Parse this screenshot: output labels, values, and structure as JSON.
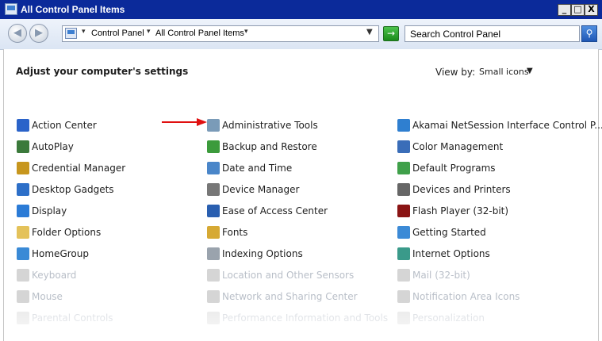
{
  "window": {
    "title": "All Control Panel Items"
  },
  "titlebar_buttons": {
    "minimize": "_",
    "maximize": "□",
    "close": "X"
  },
  "nav": {
    "back": "◀",
    "forward": "▶",
    "breadcrumbs": [
      "Control Panel",
      "All Control Panel Items"
    ],
    "refresh": "→",
    "search_placeholder": "Search Control Panel",
    "search_btn": "⚲"
  },
  "header": {
    "title": "Adjust your computer's settings",
    "view_by_label": "View by:",
    "view_by_value": "Small icons"
  },
  "items": {
    "col1": [
      {
        "label": "Action Center",
        "icon": "flag-icon",
        "color": "#2a63c9"
      },
      {
        "label": "AutoPlay",
        "icon": "autoplay-icon",
        "color": "#3b7a3b"
      },
      {
        "label": "Credential Manager",
        "icon": "vault-icon",
        "color": "#c7961e"
      },
      {
        "label": "Desktop Gadgets",
        "icon": "gadgets-icon",
        "color": "#2d6fc8"
      },
      {
        "label": "Display",
        "icon": "monitor-icon",
        "color": "#2b7bd6"
      },
      {
        "label": "Folder Options",
        "icon": "folder-icon",
        "color": "#e4c25a"
      },
      {
        "label": "HomeGroup",
        "icon": "homegroup-icon",
        "color": "#3a8ad6"
      },
      {
        "label": "Keyboard",
        "icon": "keyboard-icon",
        "color": "#888"
      },
      {
        "label": "Mouse",
        "icon": "mouse-icon",
        "color": "#888"
      },
      {
        "label": "Parental Controls",
        "icon": "parental-icon",
        "color": "#888"
      }
    ],
    "col2": [
      {
        "label": "Administrative Tools",
        "icon": "admin-tools-icon",
        "color": "#7a9bb8"
      },
      {
        "label": "Backup and Restore",
        "icon": "backup-icon",
        "color": "#3c9b3c"
      },
      {
        "label": "Date and Time",
        "icon": "clock-icon",
        "color": "#4a86c9"
      },
      {
        "label": "Device Manager",
        "icon": "device-manager-icon",
        "color": "#777"
      },
      {
        "label": "Ease of Access Center",
        "icon": "ease-access-icon",
        "color": "#2a5fb0"
      },
      {
        "label": "Fonts",
        "icon": "fonts-icon",
        "color": "#d6a934"
      },
      {
        "label": "Indexing Options",
        "icon": "indexing-icon",
        "color": "#9aa3ad"
      },
      {
        "label": "Location and Other Sensors",
        "icon": "sensors-icon",
        "color": "#888"
      },
      {
        "label": "Network and Sharing Center",
        "icon": "network-icon",
        "color": "#888"
      },
      {
        "label": "Performance Information and Tools",
        "icon": "performance-icon",
        "color": "#888"
      }
    ],
    "col3": [
      {
        "label": "Akamai NetSession Interface Control P...",
        "icon": "akamai-icon",
        "color": "#2f7fd0"
      },
      {
        "label": "Color Management",
        "icon": "color-management-icon",
        "color": "#3a6db8"
      },
      {
        "label": "Default Programs",
        "icon": "default-programs-icon",
        "color": "#3fa04a"
      },
      {
        "label": "Devices and Printers",
        "icon": "printer-icon",
        "color": "#666"
      },
      {
        "label": "Flash Player (32-bit)",
        "icon": "flash-icon",
        "color": "#8a1414"
      },
      {
        "label": "Getting Started",
        "icon": "getting-started-icon",
        "color": "#3c8ad6"
      },
      {
        "label": "Internet Options",
        "icon": "internet-options-icon",
        "color": "#3a9a8a"
      },
      {
        "label": "Mail (32-bit)",
        "icon": "mail-icon",
        "color": "#888"
      },
      {
        "label": "Notification Area Icons",
        "icon": "notification-icon",
        "color": "#888"
      },
      {
        "label": "Personalization",
        "icon": "personalization-icon",
        "color": "#888"
      }
    ]
  },
  "colors": {
    "titlebar": "#0b2a9a",
    "annotation_arrow": "#e01010"
  }
}
